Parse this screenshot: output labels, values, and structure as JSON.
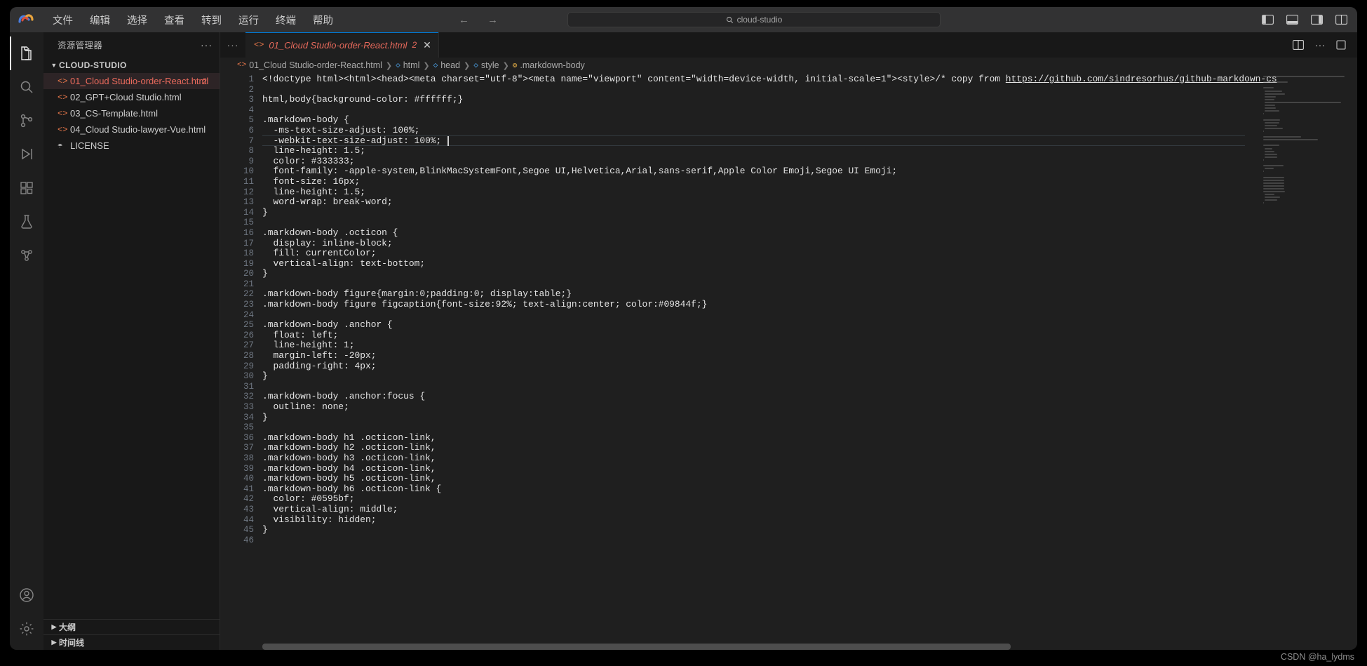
{
  "titlebar": {
    "menu": [
      "文件",
      "编辑",
      "选择",
      "查看",
      "转到",
      "运行",
      "终端",
      "帮助"
    ],
    "back_icon": "arrow-left-icon",
    "forward_icon": "arrow-right-icon",
    "search_placeholder": "cloud-studio",
    "search_icon": "search-icon",
    "layout_icons": [
      "toggle-primary-sidebar-icon",
      "toggle-panel-icon",
      "toggle-secondary-sidebar-icon",
      "customize-layout-icon"
    ]
  },
  "activitybar": {
    "items": [
      {
        "name": "explorer",
        "icon": "files-icon",
        "active": true
      },
      {
        "name": "search",
        "icon": "search-icon",
        "active": false
      },
      {
        "name": "source-control",
        "icon": "source-control-icon",
        "active": false
      },
      {
        "name": "run-and-debug",
        "icon": "debug-icon",
        "active": false
      },
      {
        "name": "extensions",
        "icon": "extensions-icon",
        "active": false
      },
      {
        "name": "testing",
        "icon": "beaker-icon",
        "active": false
      },
      {
        "name": "remote-explorer",
        "icon": "remote-icon",
        "active": false
      }
    ],
    "bottom": [
      {
        "name": "accounts",
        "icon": "account-icon"
      },
      {
        "name": "settings",
        "icon": "gear-icon"
      }
    ]
  },
  "sidebar": {
    "title": "资源管理器",
    "more_actions": "···",
    "folder": "CLOUD-STUDIO",
    "files": [
      {
        "name": "01_Cloud Studio-order-React.html",
        "icon": "html-file-icon",
        "badge": "2",
        "selected": true
      },
      {
        "name": "02_GPT+Cloud Studio.html",
        "icon": "html-file-icon",
        "badge": "",
        "selected": false
      },
      {
        "name": "03_CS-Template.html",
        "icon": "html-file-icon",
        "badge": "",
        "selected": false
      },
      {
        "name": "04_Cloud Studio-lawyer-Vue.html",
        "icon": "html-file-icon",
        "badge": "",
        "selected": false
      },
      {
        "name": "LICENSE",
        "icon": "license-file-icon",
        "badge": "",
        "selected": false
      }
    ],
    "sections": [
      {
        "label": "大纲",
        "name": "outline"
      },
      {
        "label": "时间线",
        "name": "timeline"
      }
    ]
  },
  "editor": {
    "tab": {
      "label": "01_Cloud Studio-order-React.html",
      "badge": "2",
      "icon": "html-file-icon",
      "close": "✕"
    },
    "tab_actions": [
      "split-editor-icon",
      "more-actions-icon",
      "maximize-icon"
    ],
    "breadcrumb": [
      {
        "label": "01_Cloud Studio-order-React.html",
        "icon": "html-file-icon",
        "icon_kind": "file"
      },
      {
        "label": "html",
        "icon": "symbol-html-icon",
        "icon_kind": "html"
      },
      {
        "label": "head",
        "icon": "symbol-html-icon",
        "icon_kind": "html"
      },
      {
        "label": "style",
        "icon": "symbol-html-icon",
        "icon_kind": "html"
      },
      {
        "label": ".markdown-body",
        "icon": "symbol-css-icon",
        "icon_kind": "css"
      }
    ],
    "lines": [
      {
        "n": 1,
        "text": "<!doctype html><html><head><meta charset=\"utf-8\"><meta name=\"viewport\" content=\"width=device-width, initial-scale=1\"><style>/* copy from ",
        "link": "https://github.com/sindresorhus/github-markdown-cs"
      },
      {
        "n": 2,
        "text": ""
      },
      {
        "n": 3,
        "text": "html,body{background-color: #ffffff;}"
      },
      {
        "n": 4,
        "text": ""
      },
      {
        "n": 5,
        "text": ".markdown-body {"
      },
      {
        "n": 6,
        "text": "  -ms-text-size-adjust: 100%;"
      },
      {
        "n": 7,
        "text": "  -webkit-text-size-adjust: 100%;"
      },
      {
        "n": 8,
        "text": "  line-height: 1.5;"
      },
      {
        "n": 9,
        "text": "  color: #333333;"
      },
      {
        "n": 10,
        "text": "  font-family: -apple-system,BlinkMacSystemFont,Segoe UI,Helvetica,Arial,sans-serif,Apple Color Emoji,Segoe UI Emoji;"
      },
      {
        "n": 11,
        "text": "  font-size: 16px;"
      },
      {
        "n": 12,
        "text": "  line-height: 1.5;"
      },
      {
        "n": 13,
        "text": "  word-wrap: break-word;"
      },
      {
        "n": 14,
        "text": "}"
      },
      {
        "n": 15,
        "text": ""
      },
      {
        "n": 16,
        "text": ".markdown-body .octicon {"
      },
      {
        "n": 17,
        "text": "  display: inline-block;"
      },
      {
        "n": 18,
        "text": "  fill: currentColor;"
      },
      {
        "n": 19,
        "text": "  vertical-align: text-bottom;"
      },
      {
        "n": 20,
        "text": "}"
      },
      {
        "n": 21,
        "text": ""
      },
      {
        "n": 22,
        "text": ".markdown-body figure{margin:0;padding:0; display:table;}"
      },
      {
        "n": 23,
        "text": ".markdown-body figure figcaption{font-size:92%; text-align:center; color:#09844f;}"
      },
      {
        "n": 24,
        "text": ""
      },
      {
        "n": 25,
        "text": ".markdown-body .anchor {"
      },
      {
        "n": 26,
        "text": "  float: left;"
      },
      {
        "n": 27,
        "text": "  line-height: 1;"
      },
      {
        "n": 28,
        "text": "  margin-left: -20px;"
      },
      {
        "n": 29,
        "text": "  padding-right: 4px;"
      },
      {
        "n": 30,
        "text": "}"
      },
      {
        "n": 31,
        "text": ""
      },
      {
        "n": 32,
        "text": ".markdown-body .anchor:focus {"
      },
      {
        "n": 33,
        "text": "  outline: none;"
      },
      {
        "n": 34,
        "text": "}"
      },
      {
        "n": 35,
        "text": ""
      },
      {
        "n": 36,
        "text": ".markdown-body h1 .octicon-link,"
      },
      {
        "n": 37,
        "text": ".markdown-body h2 .octicon-link,"
      },
      {
        "n": 38,
        "text": ".markdown-body h3 .octicon-link,"
      },
      {
        "n": 39,
        "text": ".markdown-body h4 .octicon-link,"
      },
      {
        "n": 40,
        "text": ".markdown-body h5 .octicon-link,"
      },
      {
        "n": 41,
        "text": ".markdown-body h6 .octicon-link {"
      },
      {
        "n": 42,
        "text": "  color: #0595bf;"
      },
      {
        "n": 43,
        "text": "  vertical-align: middle;"
      },
      {
        "n": 44,
        "text": "  visibility: hidden;"
      },
      {
        "n": 45,
        "text": "}"
      },
      {
        "n": 46,
        "text": ""
      }
    ],
    "cursor_line": 7
  },
  "watermark": "CSDN @ha_lydms",
  "colors": {
    "accent_red": "#e96a5c",
    "file_icon_orange": "#e8774a",
    "background": "#1f1f1f",
    "sidebar_bg": "#181818",
    "titlebar_bg": "#323233"
  }
}
